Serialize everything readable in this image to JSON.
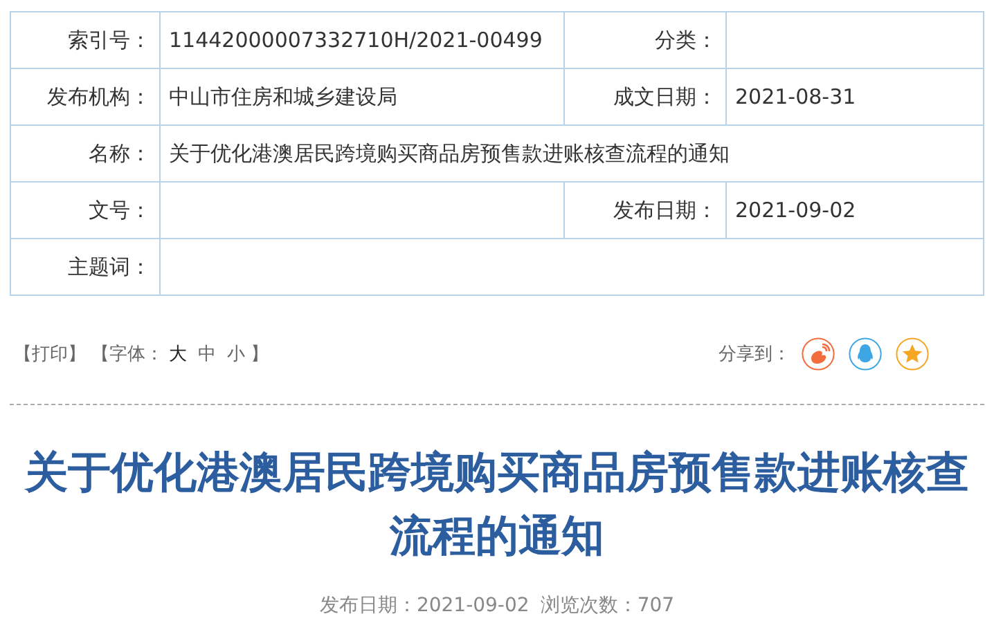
{
  "info_table": {
    "rows": [
      {
        "cells": [
          {
            "label": "索引号：",
            "value": "11442000007332710H/2021-00499"
          },
          {
            "label": "分类："
          }
        ]
      },
      {
        "cells": [
          {
            "label": "发布机构：",
            "value": "中山市住房和城乡建设局"
          },
          {
            "label": "成文日期：",
            "value": "2021-08-31"
          }
        ]
      },
      {
        "cells": [
          {
            "label": "名称：",
            "value": "关于优化港澳居民跨境购买商品房预售款进账核查流程的通知"
          }
        ]
      },
      {
        "cells": [
          {
            "label": "文号："
          },
          {
            "label": "发布日期：",
            "value": "2021-09-02"
          }
        ]
      },
      {
        "cells": [
          {
            "label": "主题词："
          }
        ]
      }
    ]
  },
  "toolbar": {
    "print": "【打印】",
    "font_prefix": "【字体：",
    "font_sizes": [
      {
        "label": "大",
        "selected": true
      },
      {
        "label": "中",
        "selected": false
      },
      {
        "label": "小",
        "selected": false
      }
    ],
    "font_suffix": "】",
    "share_label": "分享到：",
    "share_targets": [
      {
        "kind": "swirl",
        "color": "#f26d3d"
      },
      {
        "kind": "penguin",
        "color": "#3fa6e6"
      },
      {
        "kind": "star",
        "color": "#f5a623"
      }
    ]
  },
  "article": {
    "title": "关于优化港澳居民跨境购买商品房预售款进账核查流程的通知",
    "publish_date": "发布日期：2021-09-02",
    "views": "浏览次数：707"
  }
}
